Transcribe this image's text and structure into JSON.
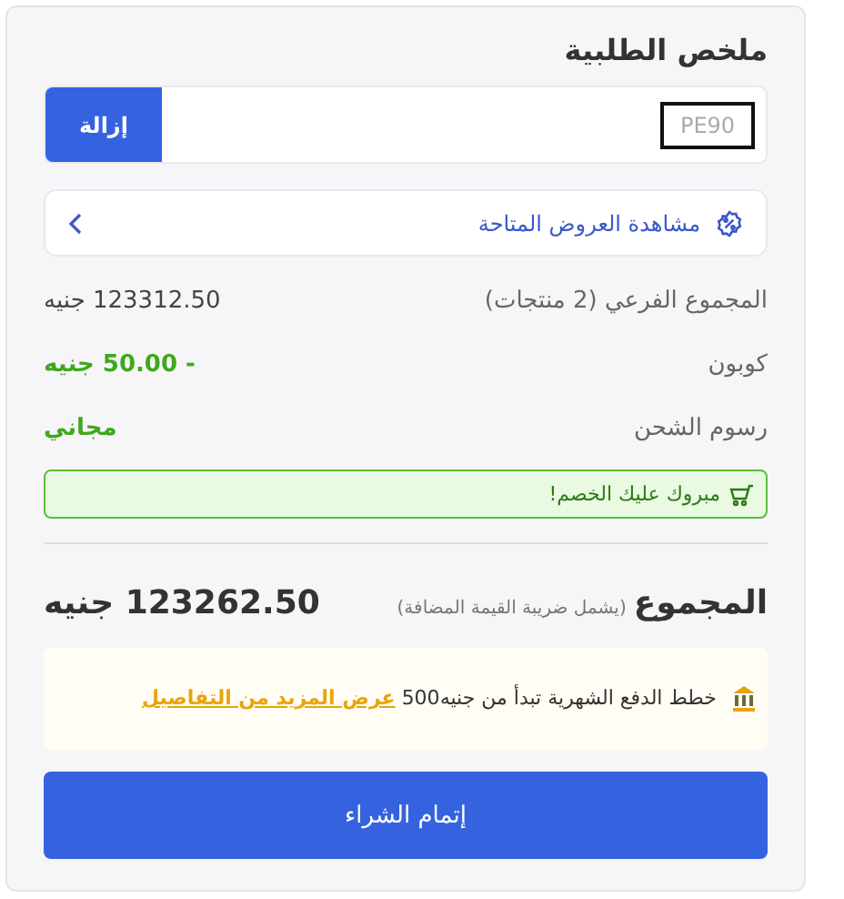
{
  "title": "ملخص الطلبية",
  "coupon": {
    "value": "PE90",
    "button": "إزالة"
  },
  "offers_link": "مشاهدة العروض المتاحة",
  "summary_rows": [
    {
      "label": "المجموع الفرعي (2 منتجات)",
      "value": "123312.50 جنيه",
      "kind": "plain"
    },
    {
      "label": "كوبون",
      "value": "- 50.00 جنيه",
      "kind": "discount"
    },
    {
      "label": "رسوم الشحن",
      "value": "مجاني",
      "kind": "discount"
    }
  ],
  "success_message": "مبروك عليك الخصم!",
  "total": {
    "label": "المجموع",
    "note": "(يشمل ضريبة القيمة المضافة)",
    "value": "123262.50 جنيه"
  },
  "installments": {
    "text": "خطط الدفع الشهرية تبدأ من جنيه500",
    "link": "عرض المزيد من التفاصيل"
  },
  "checkout_button": "إتمام الشراء"
}
